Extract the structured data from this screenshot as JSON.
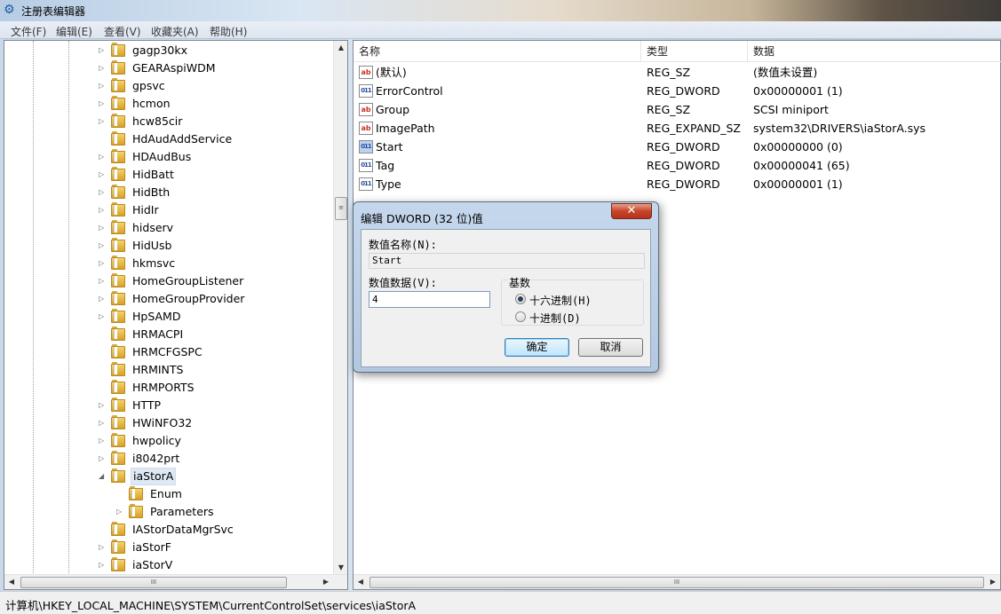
{
  "window": {
    "title": "注册表编辑器"
  },
  "menu": [
    "文件(F)",
    "编辑(E)",
    "查看(V)",
    "收藏夹(A)",
    "帮助(H)"
  ],
  "tree": {
    "items": [
      {
        "label": "gagp30kx",
        "level": 0,
        "expander": "▷"
      },
      {
        "label": "GEARAspiWDM",
        "level": 0,
        "expander": "▷"
      },
      {
        "label": "gpsvc",
        "level": 0,
        "expander": "▷"
      },
      {
        "label": "hcmon",
        "level": 0,
        "expander": "▷"
      },
      {
        "label": "hcw85cir",
        "level": 0,
        "expander": "▷"
      },
      {
        "label": "HdAudAddService",
        "level": 0,
        "expander": ""
      },
      {
        "label": "HDAudBus",
        "level": 0,
        "expander": "▷"
      },
      {
        "label": "HidBatt",
        "level": 0,
        "expander": "▷"
      },
      {
        "label": "HidBth",
        "level": 0,
        "expander": "▷"
      },
      {
        "label": "HidIr",
        "level": 0,
        "expander": "▷"
      },
      {
        "label": "hidserv",
        "level": 0,
        "expander": "▷"
      },
      {
        "label": "HidUsb",
        "level": 0,
        "expander": "▷"
      },
      {
        "label": "hkmsvc",
        "level": 0,
        "expander": "▷"
      },
      {
        "label": "HomeGroupListener",
        "level": 0,
        "expander": "▷"
      },
      {
        "label": "HomeGroupProvider",
        "level": 0,
        "expander": "▷"
      },
      {
        "label": "HpSAMD",
        "level": 0,
        "expander": "▷"
      },
      {
        "label": "HRMACPI",
        "level": 0,
        "expander": ""
      },
      {
        "label": "HRMCFGSPC",
        "level": 0,
        "expander": ""
      },
      {
        "label": "HRMINTS",
        "level": 0,
        "expander": ""
      },
      {
        "label": "HRMPORTS",
        "level": 0,
        "expander": ""
      },
      {
        "label": "HTTP",
        "level": 0,
        "expander": "▷"
      },
      {
        "label": "HWiNFO32",
        "level": 0,
        "expander": "▷"
      },
      {
        "label": "hwpolicy",
        "level": 0,
        "expander": "▷"
      },
      {
        "label": "i8042prt",
        "level": 0,
        "expander": "▷"
      },
      {
        "label": "iaStorA",
        "level": 0,
        "expander": "◢",
        "selected": true
      },
      {
        "label": "Enum",
        "level": 1,
        "expander": ""
      },
      {
        "label": "Parameters",
        "level": 1,
        "expander": "▷"
      },
      {
        "label": "IAStorDataMgrSvc",
        "level": 0,
        "expander": ""
      },
      {
        "label": "iaStorF",
        "level": 0,
        "expander": "▷"
      },
      {
        "label": "iaStorV",
        "level": 0,
        "expander": "▷"
      }
    ],
    "scroll_thumb_glyph": "≡",
    "hscroll_thumb_glyph": "III"
  },
  "list": {
    "headers": [
      "名称",
      "类型",
      "数据"
    ],
    "rows": [
      {
        "icon": "ab",
        "icon_kind": "sz",
        "name": "(默认)",
        "type": "REG_SZ",
        "data": "(数值未设置)"
      },
      {
        "icon": "011",
        "icon_kind": "dword",
        "name": "ErrorControl",
        "type": "REG_DWORD",
        "data": "0x00000001 (1)"
      },
      {
        "icon": "ab",
        "icon_kind": "sz",
        "name": "Group",
        "type": "REG_SZ",
        "data": "SCSI miniport"
      },
      {
        "icon": "ab",
        "icon_kind": "sz",
        "name": "ImagePath",
        "type": "REG_EXPAND_SZ",
        "data": "system32\\DRIVERS\\iaStorA.sys"
      },
      {
        "icon": "011",
        "icon_kind": "dword",
        "name": "Start",
        "type": "REG_DWORD",
        "data": "0x00000000 (0)",
        "highlight": true
      },
      {
        "icon": "011",
        "icon_kind": "dword",
        "name": "Tag",
        "type": "REG_DWORD",
        "data": "0x00000041 (65)"
      },
      {
        "icon": "011",
        "icon_kind": "dword",
        "name": "Type",
        "type": "REG_DWORD",
        "data": "0x00000001 (1)"
      }
    ],
    "hscroll_thumb_glyph": "III"
  },
  "dialog": {
    "title": "编辑 DWORD (32 位)值",
    "close_glyph": "✕",
    "name_label": "数值名称(N):",
    "name_value": "Start",
    "data_label": "数值数据(V):",
    "data_value": "4",
    "base_label": "基数",
    "radio_hex": "十六进制(H)",
    "radio_dec": "十进制(D)",
    "selected_base": "hex",
    "ok": "确定",
    "cancel": "取消"
  },
  "status": {
    "path": "计算机\\HKEY_LOCAL_MACHINE\\SYSTEM\\CurrentControlSet\\services\\iaStorA"
  },
  "arrows": {
    "up": "▲",
    "down": "▼",
    "left": "◀",
    "right": "▶"
  }
}
